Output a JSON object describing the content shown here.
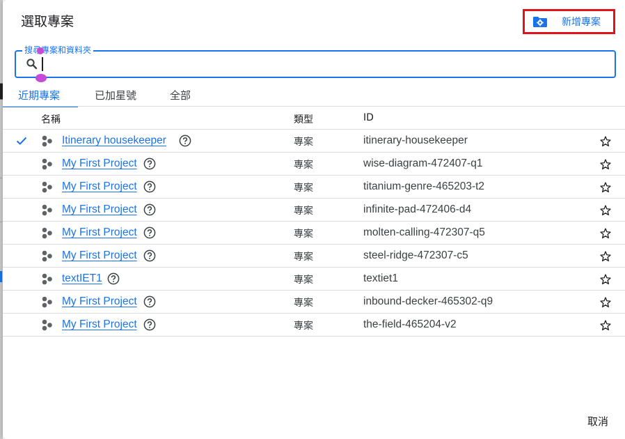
{
  "dialog": {
    "title": "選取專案",
    "new_project_label": "新增專案",
    "new_project_icon": "folder-settings-icon",
    "accent_color": "#1a73e8",
    "highlight_color": "#e0121b"
  },
  "search": {
    "label": "搜尋專案和資料夾",
    "value": "",
    "icon": "search-icon"
  },
  "tabs": [
    {
      "label": "近期專案",
      "active": true
    },
    {
      "label": "已加星號",
      "active": false
    },
    {
      "label": "全部",
      "active": false
    }
  ],
  "table": {
    "columns": {
      "name": "名稱",
      "type": "類型",
      "id": "ID"
    },
    "rows": [
      {
        "name": "Itinerary housekeeper",
        "type": "專案",
        "id": "itinerary-housekeeper",
        "selected": true
      },
      {
        "name": "My First Project",
        "type": "專案",
        "id": "wise-diagram-472407-q1",
        "selected": false
      },
      {
        "name": "My First Project",
        "type": "專案",
        "id": "titanium-genre-465203-t2",
        "selected": false
      },
      {
        "name": "My First Project",
        "type": "專案",
        "id": "infinite-pad-472406-d4",
        "selected": false
      },
      {
        "name": "My First Project",
        "type": "專案",
        "id": "molten-calling-472307-q5",
        "selected": false
      },
      {
        "name": "My First Project",
        "type": "專案",
        "id": "steel-ridge-472307-c5",
        "selected": false
      },
      {
        "name": "textIET1",
        "type": "專案",
        "id": "textiet1",
        "selected": false
      },
      {
        "name": "My First Project",
        "type": "專案",
        "id": "inbound-decker-465302-q9",
        "selected": false
      },
      {
        "name": "My First Project",
        "type": "專案",
        "id": "the-field-465204-v2",
        "selected": false
      }
    ]
  },
  "footer": {
    "cancel_label": "取消"
  }
}
